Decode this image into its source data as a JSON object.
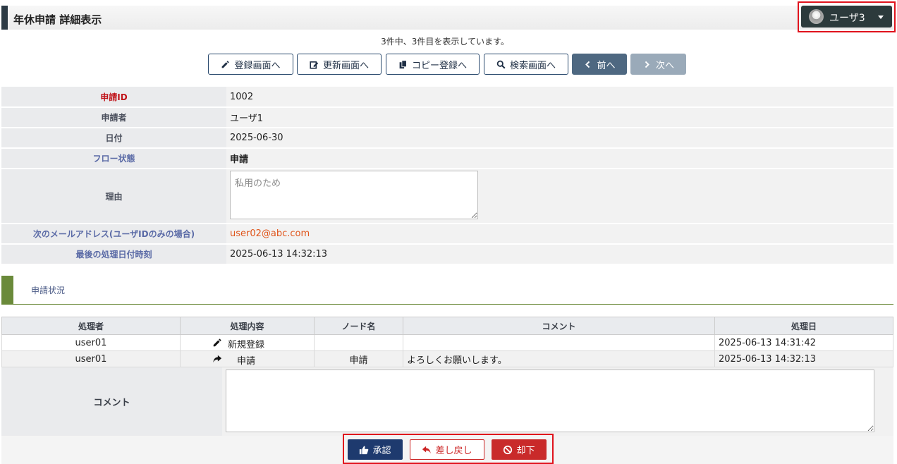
{
  "header": {
    "title": "年休申請 詳細表示"
  },
  "user_menu": {
    "name": "ユーザ3",
    "icon": "user-avatar-icon"
  },
  "record_count_text": "3件中、3件目を表示しています。",
  "nav": {
    "register": "登録画面へ",
    "update": "更新画面へ",
    "copy_register": "コピー登録へ",
    "search": "検索画面へ",
    "prev": "前へ",
    "next": "次へ"
  },
  "detail": {
    "rows": [
      {
        "label": "申請ID",
        "value": "1002"
      },
      {
        "label": "申請者",
        "value": "ユーザ1"
      },
      {
        "label": "日付",
        "value": "2025-06-30"
      },
      {
        "label": "フロー状態",
        "value": "申請"
      },
      {
        "label": "理由",
        "value": "私用のため"
      },
      {
        "label": "次のメールアドレス(ユーザIDのみの場合)",
        "value": "user02@abc.com"
      },
      {
        "label": "最後の処理日付時刻",
        "value": "2025-06-13 14:32:13"
      }
    ]
  },
  "section": {
    "title": "申請状況"
  },
  "history": {
    "columns": [
      "処理者",
      "処理内容",
      "ノード名",
      "コメント",
      "処理日"
    ],
    "rows": [
      {
        "user": "user01",
        "action": "新規登録",
        "action_icon": "pencil-icon",
        "node": "",
        "comment": "",
        "date": "2025-06-13 14:31:42"
      },
      {
        "user": "user01",
        "action": "申請",
        "action_icon": "share-arrow-icon",
        "node": "申請",
        "comment": "よろしくお願いします。",
        "date": "2025-06-13 14:32:13"
      }
    ]
  },
  "comment": {
    "label": "コメント",
    "value": ""
  },
  "actions": {
    "approve": "承認",
    "send_back": "差し戻し",
    "reject": "却下"
  },
  "colors": {
    "accent": "#2c3a44",
    "section": "#6a8a3a",
    "approve": "#1e3a6e",
    "danger": "#c92a2a",
    "highlight": "#e0131d"
  }
}
